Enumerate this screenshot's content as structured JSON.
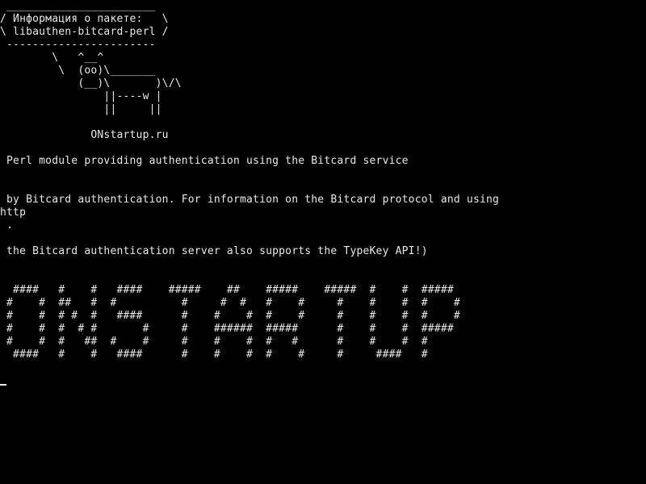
{
  "terminal": {
    "lines": [
      " _______________________",
      "/ Информация о пакете:   \\",
      "\\ libauthen-bitcard-perl /",
      " -----------------------",
      "        \\   ^__^",
      "         \\  (oo)\\_______",
      "            (__)\\       )\\/\\",
      "                ||----w |",
      "                ||     ||",
      "",
      "              ONstartup.ru",
      "",
      " Perl module providing authentication using the Bitcard service",
      "",
      "",
      " by Bitcard authentication. For information on the Bitcard protocol and using",
      "http",
      " .",
      "",
      " the Bitcard authentication server also supports the TypeKey API!)",
      "",
      "",
      "  ####   #    #   ####    #####    ##    #####    #####  #    #  #####",
      " #    #  ##   #  #          #     #  #   #    #     #    #    #  #    #",
      " #    #  # #  #   ####      #    #    #  #    #     #    #    #  #    #",
      " #    #  #  # #       #     #    ######  #####      #    #    #  #####",
      " #    #  #   ##  #    #     #    #    #  #   #      #    #    #  #",
      "  ####   #    #   ####      #    #    #  #    #     #     ####   #",
      "",
      ""
    ],
    "cursor": "_",
    "colors": {
      "background": "#000000",
      "foreground": "#e8e8e8"
    }
  }
}
